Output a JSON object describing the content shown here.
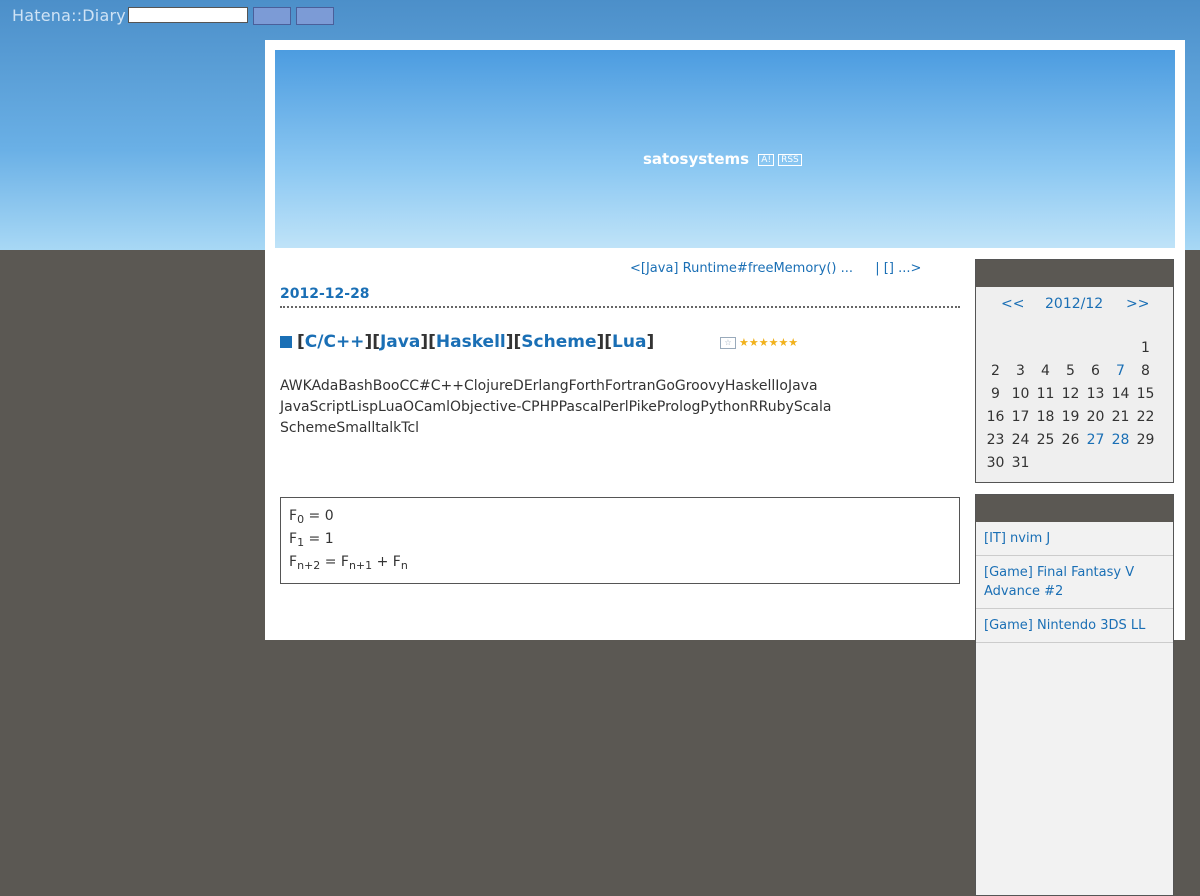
{
  "topbar": {
    "logo": "Hatena::Diary",
    "search_value": ""
  },
  "header": {
    "title": "satosystems",
    "badge_1": "A!",
    "badge_2": "RSS"
  },
  "nav": {
    "prev": "<[Java] Runtime#freeMemory() ...",
    "next": "| [] ...>"
  },
  "entry": {
    "date": "2012-12-28",
    "categories": [
      "C/C++",
      "Java",
      "Haskell",
      "Scheme",
      "Lua"
    ],
    "star_add": "☆",
    "stars": "★★★★★★",
    "body_lines": [
      "AWKAdaBashBooCC#C++ClojureDErlangForthFortranGoGroovyHaskellIoJava",
      "JavaScriptLispLuaOCamlObjective-CPHPPascalPerlPikePrologPythonRRubyScala",
      "SchemeSmalltalkTcl"
    ],
    "formula": {
      "l1_a": "F",
      "l1_sub": "0",
      "l1_b": " = 0",
      "l2_a": "F",
      "l2_sub": "1",
      "l2_b": " = 1",
      "l3_a": "F",
      "l3_sub1": "n+2",
      "l3_b": " = F",
      "l3_sub2": "n+1",
      "l3_c": " + F",
      "l3_sub3": "n"
    }
  },
  "calendar": {
    "prev": "<<",
    "month": "2012/12",
    "next": ">>",
    "days": [
      "1",
      "2",
      "3",
      "4",
      "5",
      "6",
      "7",
      "8",
      "9",
      "10",
      "11",
      "12",
      "13",
      "14",
      "15",
      "16",
      "17",
      "18",
      "19",
      "20",
      "21",
      "22",
      "23",
      "24",
      "25",
      "26",
      "27",
      "28",
      "29",
      "30",
      "31"
    ]
  },
  "recent": {
    "items": [
      "[IT] nvim  J",
      "[Game] Final Fantasy V Advance #2",
      "[Game] Nintendo 3DS LL"
    ]
  },
  "colors": {
    "link": "#1a6fb5",
    "background": "#5b5853",
    "sky": "#4c8fc9"
  }
}
